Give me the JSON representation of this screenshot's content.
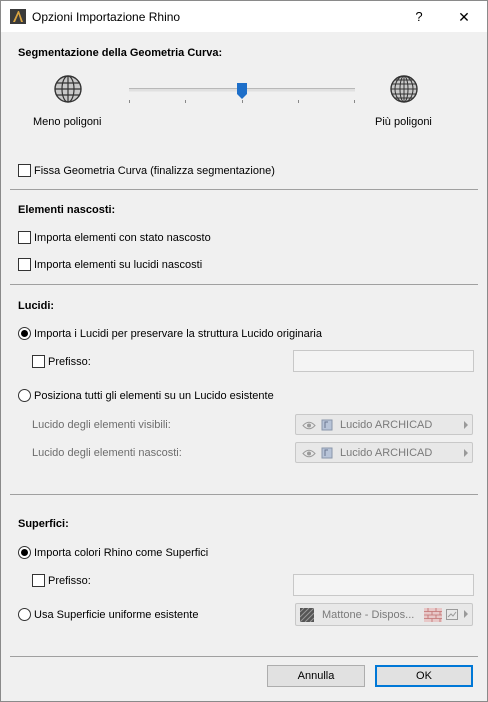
{
  "window": {
    "title": "Opzioni Importazione Rhino",
    "help_label": "?",
    "close_label": "✕"
  },
  "segmentation": {
    "title": "Segmentazione della Geometria Curva:",
    "less_label": "Meno poligoni",
    "more_label": "Più poligoni",
    "slider_level": 0.5,
    "fix_geometry_label": "Fissa Geometria Curva (finalizza segmentazione)",
    "fix_geometry_checked": false
  },
  "hidden_elements": {
    "title": "Elementi nascosti:",
    "import_hidden_label": "Importa elementi con stato nascosto",
    "import_hidden_checked": false,
    "import_hidden_layers_label": "Importa elementi su lucidi nascosti",
    "import_hidden_layers_checked": false
  },
  "layers": {
    "title": "Lucidi:",
    "preserve_label": "Importa i Lucidi per preservare la struttura Lucido originaria",
    "preserve_selected": true,
    "prefix_label": "Prefisso:",
    "prefix_checked": false,
    "prefix_value": "",
    "existing_label": "Posiziona tutti gli elementi su un Lucido esistente",
    "existing_selected": false,
    "visible_layer_label": "Lucido degli elementi visibili:",
    "visible_layer_value": "Lucido ARCHICAD",
    "hidden_layer_label": "Lucido degli elementi nascosti:",
    "hidden_layer_value": "Lucido ARCHICAD"
  },
  "surfaces": {
    "title": "Superfici:",
    "import_colors_label": "Importa colori Rhino come Superfici",
    "import_colors_selected": true,
    "prefix_label": "Prefisso:",
    "prefix_checked": false,
    "prefix_value": "",
    "uniform_label": "Usa Superficie uniforme esistente",
    "uniform_selected": false,
    "uniform_value": "Mattone - Dispos..."
  },
  "buttons": {
    "cancel_label": "Annulla",
    "ok_label": "OK"
  },
  "colors": {
    "accent": "#0078d7",
    "thumb": "#1e6fc9",
    "dialog_bg": "#f0f0f0"
  }
}
